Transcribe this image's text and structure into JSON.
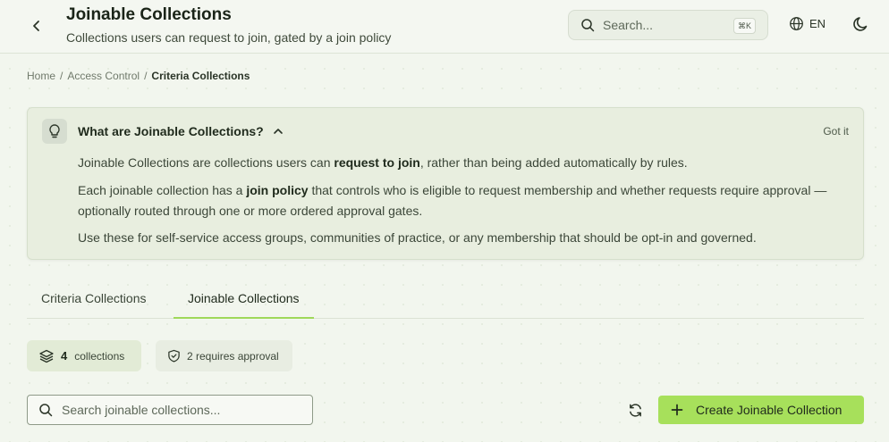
{
  "header": {
    "title": "Joinable Collections",
    "subtitle": "Collections users can request to join, gated by a join policy",
    "search_placeholder": "Search...",
    "search_shortcut": "⌘K",
    "language": "EN"
  },
  "breadcrumb": {
    "items": [
      "Home",
      "Access Control"
    ],
    "separator": "/",
    "current": "Criteria Collections"
  },
  "info": {
    "title": "What are Joinable Collections?",
    "dismiss": "Got it",
    "p1_before": "Joinable Collections are collections users can ",
    "p1_bold": "request to join",
    "p1_after": ", rather than being added automatically by rules.",
    "p2_before": "Each joinable collection has a ",
    "p2_bold": "join policy",
    "p2_after": " that controls who is eligible to request membership and whether requests require approval — optionally routed through one or more ordered approval gates.",
    "p3": "Use these for self-service access groups, communities of practice, or any membership that should be opt-in and governed."
  },
  "tabs": [
    {
      "label": "Criteria Collections",
      "active": false
    },
    {
      "label": "Joinable Collections",
      "active": true
    }
  ],
  "stats": {
    "count": "4",
    "count_label": "collections",
    "approval_label": "2 requires approval"
  },
  "toolbar": {
    "search_placeholder": "Search joinable collections...",
    "create_label": "Create Joinable Collection"
  },
  "colors": {
    "accent": "#a7e05b",
    "tab_underline": "#9fd85a",
    "background": "#f2f6ee",
    "card": "#e8eedf"
  }
}
